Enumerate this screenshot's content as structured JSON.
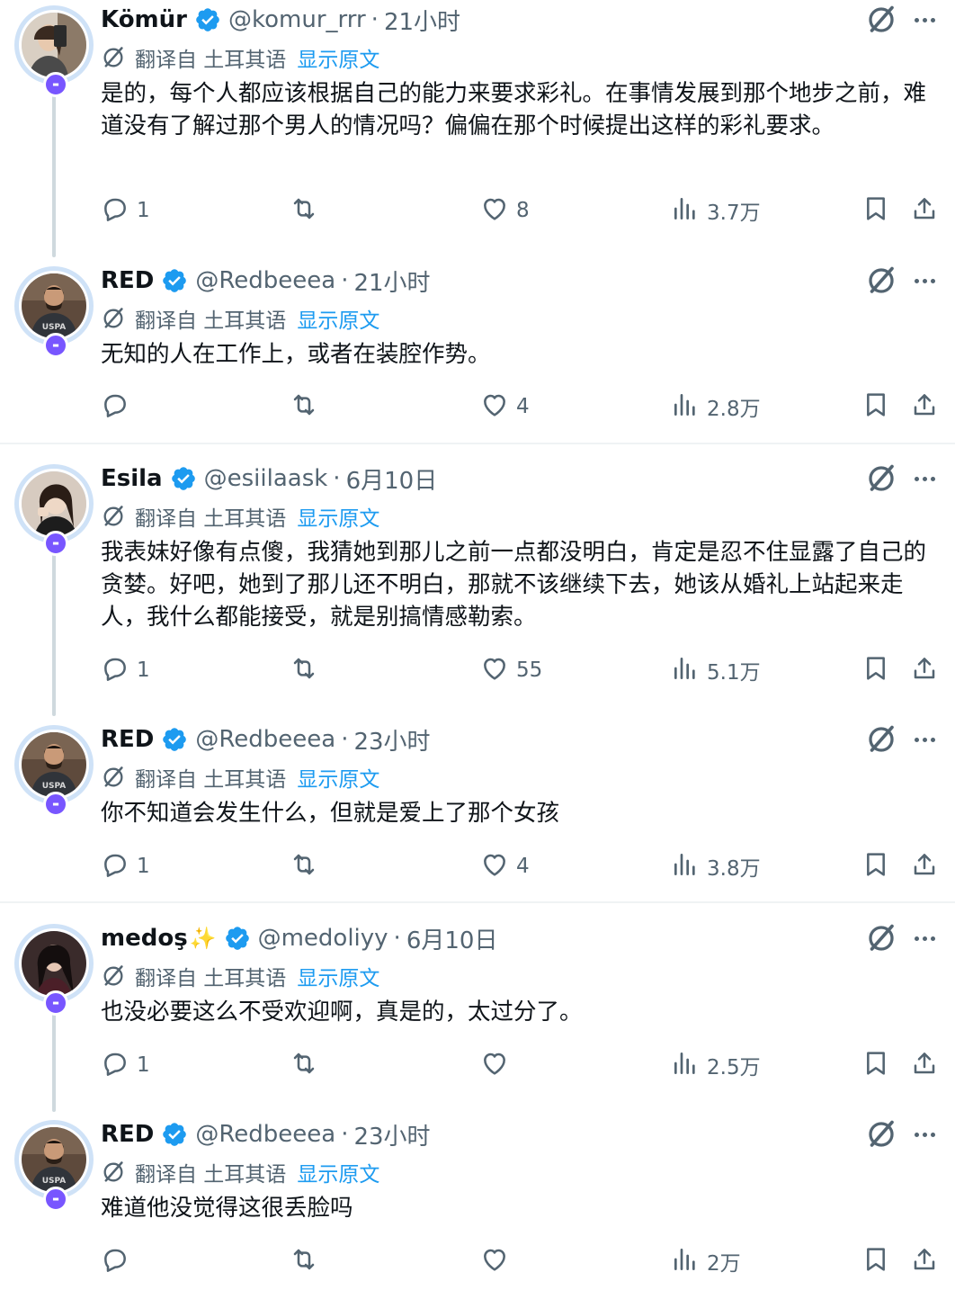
{
  "ui": {
    "translate_label": "翻译自 土耳其语",
    "show_original": "显示原文",
    "badge_symbol": "-",
    "separator": "·",
    "accent_color": "#1d9bf0",
    "badge_color": "#7856ff",
    "icons": [
      "verified-badge-icon",
      "grok-icon",
      "more-icon",
      "translate-icon",
      "reply-icon",
      "repost-icon",
      "like-icon",
      "views-icon",
      "bookmark-icon",
      "share-icon"
    ]
  },
  "tweets": [
    {
      "name": "Kömür",
      "sparkle": "",
      "handle": "@komur_rrr",
      "time": "21小时",
      "text": "是的，每个人都应该根据自己的能力来要求彩礼。在事情发展到那个地步之前，难道没有了解过那个男人的情况吗？偏偏在那个时候提出这样的彩礼要求。",
      "replies": "1",
      "reposts": "",
      "likes": "8",
      "views": "3.7万"
    },
    {
      "name": "RED",
      "sparkle": "",
      "handle": "@Redbeeea",
      "time": "21小时",
      "text": "无知的人在工作上，或者在装腔作势。",
      "replies": "",
      "reposts": "",
      "likes": "4",
      "views": "2.8万"
    },
    {
      "name": "Esila",
      "sparkle": "",
      "handle": "@esiilaask",
      "time": "6月10日",
      "text": "我表妹好像有点傻，我猜她到那儿之前一点都没明白，肯定是忍不住显露了自己的贪婪。好吧，她到了那儿还不明白，那就不该继续下去，她该从婚礼上站起来走人，我什么都能接受，就是别搞情感勒索。",
      "replies": "1",
      "reposts": "",
      "likes": "55",
      "views": "5.1万"
    },
    {
      "name": "RED",
      "sparkle": "",
      "handle": "@Redbeeea",
      "time": "23小时",
      "text": "你不知道会发生什么，但就是爱上了那个女孩",
      "replies": "1",
      "reposts": "",
      "likes": "4",
      "views": "3.8万"
    },
    {
      "name": "medoş",
      "sparkle": "✨",
      "handle": "@medoliyy",
      "time": "6月10日",
      "text": "也没必要这么不受欢迎啊，真是的，太过分了。",
      "replies": "1",
      "reposts": "",
      "likes": "",
      "views": "2.5万"
    },
    {
      "name": "RED",
      "sparkle": "",
      "handle": "@Redbeeea",
      "time": "23小时",
      "text": "难道他没觉得这很丢脸吗",
      "replies": "",
      "reposts": "",
      "likes": "",
      "views": "2万"
    }
  ]
}
